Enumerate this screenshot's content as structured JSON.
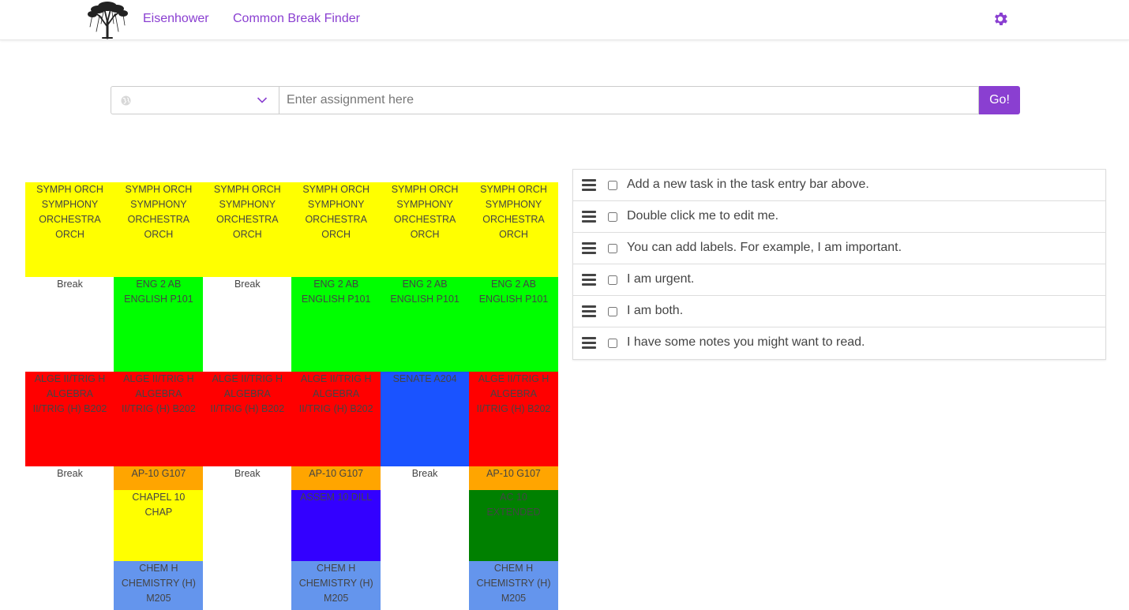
{
  "nav": {
    "brand": "Eisenhower",
    "link": "Common Break Finder",
    "settings_icon": "gear-icon",
    "accent": "#8a3fd1"
  },
  "entry": {
    "placeholder": "Enter assignment here",
    "go_label": "Go!"
  },
  "schedule": {
    "columns": [
      {
        "cells": [
          {
            "lines": [
              "SYMPH ORCH",
              "SYMPHONY",
              "ORCHESTRA",
              "ORCH"
            ],
            "color": "#ffff00"
          },
          {
            "lines": [
              "Break"
            ],
            "color": "#ffffff"
          },
          {
            "lines": [
              "ALGE II/TRIG H",
              "ALGEBRA",
              "II/TRIG (H) B202"
            ],
            "color": "#ff0000"
          },
          {
            "lines": [
              "Break"
            ],
            "color": "#ffffff"
          }
        ]
      },
      {
        "cells": [
          {
            "lines": [
              "SYMPH ORCH",
              "SYMPHONY",
              "ORCHESTRA",
              "ORCH"
            ],
            "color": "#ffff00"
          },
          {
            "lines": [
              "ENG 2 AB",
              "ENGLISH P101"
            ],
            "color": "#00ff00"
          },
          {
            "lines": [
              "ALGE II/TRIG H",
              "ALGEBRA",
              "II/TRIG (H) B202"
            ],
            "color": "#ff0000"
          },
          {
            "lines": [
              "AP-10 G107"
            ],
            "color": "#ffa500"
          },
          {
            "lines": [
              "CHAPEL 10",
              "CHAP"
            ],
            "color": "#ffff00"
          },
          {
            "lines": [
              "CHEM H",
              "CHEMISTRY (H)",
              "M205"
            ],
            "color": "#6495ed"
          }
        ]
      },
      {
        "cells": [
          {
            "lines": [
              "SYMPH ORCH",
              "SYMPHONY",
              "ORCHESTRA",
              "ORCH"
            ],
            "color": "#ffff00"
          },
          {
            "lines": [
              "Break"
            ],
            "color": "#ffffff"
          },
          {
            "lines": [
              "ALGE II/TRIG H",
              "ALGEBRA",
              "II/TRIG (H) B202"
            ],
            "color": "#ff0000"
          },
          {
            "lines": [
              "Break"
            ],
            "color": "#ffffff"
          }
        ]
      },
      {
        "cells": [
          {
            "lines": [
              "SYMPH ORCH",
              "SYMPHONY",
              "ORCHESTRA",
              "ORCH"
            ],
            "color": "#ffff00"
          },
          {
            "lines": [
              "ENG 2 AB",
              "ENGLISH P101"
            ],
            "color": "#00ff00"
          },
          {
            "lines": [
              "ALGE II/TRIG H",
              "ALGEBRA",
              "II/TRIG (H) B202"
            ],
            "color": "#ff0000"
          },
          {
            "lines": [
              "AP-10 G107"
            ],
            "color": "#ffa500"
          },
          {
            "lines": [
              "ASSEM 10 DILL"
            ],
            "color": "#3300ff"
          },
          {
            "lines": [
              "CHEM H",
              "CHEMISTRY (H)",
              "M205"
            ],
            "color": "#6495ed"
          }
        ]
      },
      {
        "cells": [
          {
            "lines": [
              "SYMPH ORCH",
              "SYMPHONY",
              "ORCHESTRA",
              "ORCH"
            ],
            "color": "#ffff00"
          },
          {
            "lines": [
              "ENG 2 AB",
              "ENGLISH P101"
            ],
            "color": "#00ff00"
          },
          {
            "lines": [
              "SENATE A204"
            ],
            "color": "#1a53ff"
          },
          {
            "lines": [
              "Break"
            ],
            "color": "#ffffff"
          }
        ]
      },
      {
        "cells": [
          {
            "lines": [
              "SYMPH ORCH",
              "SYMPHONY",
              "ORCHESTRA",
              "ORCH"
            ],
            "color": "#ffff00"
          },
          {
            "lines": [
              "ENG 2 AB",
              "ENGLISH P101"
            ],
            "color": "#00ff00"
          },
          {
            "lines": [
              "ALGE II/TRIG H",
              "ALGEBRA",
              "II/TRIG (H) B202"
            ],
            "color": "#ff0000"
          },
          {
            "lines": [
              "AP-10 G107"
            ],
            "color": "#ffa500"
          },
          {
            "lines": [
              "AC 10",
              "EXTENDED"
            ],
            "color": "#008000"
          },
          {
            "lines": [
              "CHEM H",
              "CHEMISTRY (H)",
              "M205"
            ],
            "color": "#6495ed"
          }
        ]
      }
    ]
  },
  "tasks": [
    {
      "text": "Add a new task in the task entry bar above."
    },
    {
      "text": "Double click me to edit me."
    },
    {
      "text": "You can add labels. For example, I am important."
    },
    {
      "text": "I am urgent."
    },
    {
      "text": "I am both."
    },
    {
      "text": "I have some notes you might want to read."
    }
  ]
}
